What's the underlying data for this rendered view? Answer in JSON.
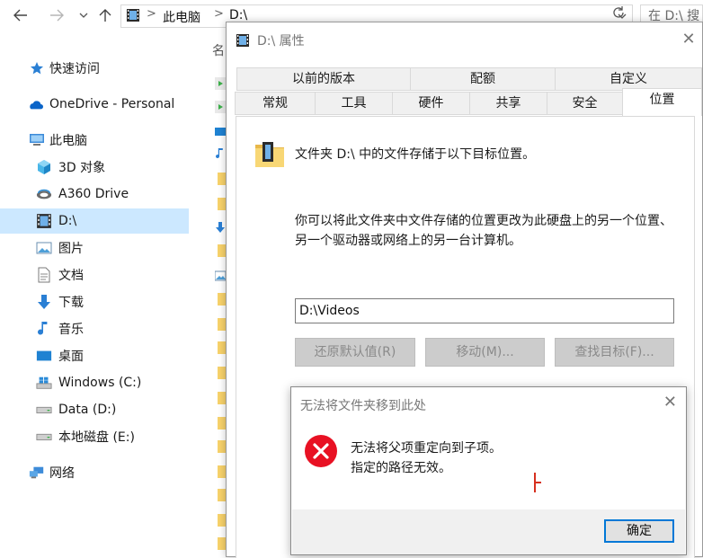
{
  "topbar": {
    "back_icon": "arrow-left-icon",
    "forward_icon": "arrow-right-icon",
    "recent_icon": "chevron-down-icon",
    "up_icon": "arrow-up-icon",
    "crumb_1": "此电脑",
    "crumb_2": "D:\\",
    "search_placeholder": "在 D:\\ 搜"
  },
  "sidebar": {
    "items": [
      {
        "label": "快速访问",
        "icon": "star-icon"
      },
      {
        "label": "OneDrive - Personal",
        "icon": "cloud-icon"
      },
      {
        "label": "此电脑",
        "icon": "computer-icon"
      },
      {
        "label": "3D 对象",
        "icon": "cube-icon"
      },
      {
        "label": "A360 Drive",
        "icon": "a360-icon"
      },
      {
        "label": "D:\\",
        "icon": "video-folder-icon",
        "selected": true
      },
      {
        "label": "图片",
        "icon": "pictures-icon"
      },
      {
        "label": "文档",
        "icon": "document-icon"
      },
      {
        "label": "下载",
        "icon": "download-icon"
      },
      {
        "label": "音乐",
        "icon": "music-icon"
      },
      {
        "label": "桌面",
        "icon": "desktop-icon"
      },
      {
        "label": "Windows (C:)",
        "icon": "windows-drive-icon"
      },
      {
        "label": "Data (D:)",
        "icon": "drive-icon"
      },
      {
        "label": "本地磁盘 (E:)",
        "icon": "drive-icon"
      },
      {
        "label": "网络",
        "icon": "network-icon"
      }
    ]
  },
  "list": {
    "column_name": "名"
  },
  "properties": {
    "title": "D:\\ 属性",
    "tabs_row1": [
      "以前的版本",
      "配额",
      "自定义"
    ],
    "tabs_row2": [
      "常规",
      "工具",
      "硬件",
      "共享",
      "安全",
      "位置"
    ],
    "active_tab": "位置",
    "info_text": "文件夹 D:\\ 中的文件存储于以下目标位置。",
    "desc_text": "你可以将此文件夹中文件存储的位置更改为此硬盘上的另一个位置、另一个驱动器或网络上的另一台计算机。",
    "path_value": "D:\\Videos",
    "btn_restore": "还原默认值(R)",
    "btn_move": "移动(M)...",
    "btn_find": "查找目标(F)..."
  },
  "error_dialog": {
    "title": "无法将文件夹移到此处",
    "message_line1": "无法将父项重定向到子项。",
    "message_line2": "指定的路径无效。",
    "ok_label": "确定",
    "icon": "error-icon",
    "accent_color": "#e81123"
  },
  "colors": {
    "selection_bg": "#cce8ff",
    "focus_border": "#0078d7"
  }
}
